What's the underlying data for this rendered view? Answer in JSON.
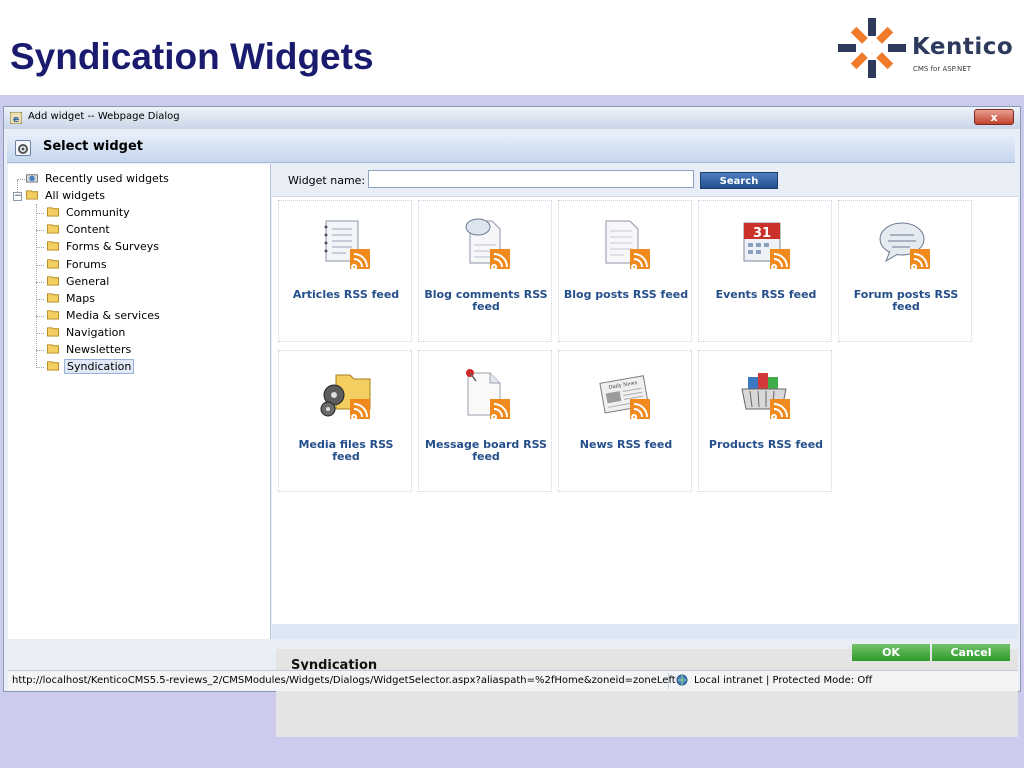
{
  "slide": {
    "title": "Syndication Widgets",
    "logo_name": "Kentico",
    "logo_tagline": "CMS for ASP.NET"
  },
  "window": {
    "title": "Add widget -- Webpage Dialog",
    "close_label": "x"
  },
  "dialog": {
    "header": "Select widget"
  },
  "tree": {
    "recent": "Recently used widgets",
    "root": "All widgets",
    "items": [
      "Community",
      "Content",
      "Forms & Surveys",
      "Forums",
      "General",
      "Maps",
      "Media & services",
      "Navigation",
      "Newsletters",
      "Syndication"
    ],
    "selected": "Syndication"
  },
  "search": {
    "label": "Widget name:",
    "value": "",
    "button": "Search"
  },
  "widgets": [
    {
      "name": "Articles RSS feed",
      "icon": "articles-rss-icon"
    },
    {
      "name": "Blog comments RSS feed",
      "icon": "blog-comments-rss-icon"
    },
    {
      "name": "Blog posts RSS feed",
      "icon": "blog-posts-rss-icon"
    },
    {
      "name": "Events RSS feed",
      "icon": "events-rss-icon"
    },
    {
      "name": "Forum posts RSS feed",
      "icon": "forum-posts-rss-icon"
    },
    {
      "name": "Media files RSS feed",
      "icon": "media-files-rss-icon"
    },
    {
      "name": "Message board RSS feed",
      "icon": "message-board-rss-icon"
    },
    {
      "name": "News RSS feed",
      "icon": "news-rss-icon"
    },
    {
      "name": "Products RSS feed",
      "icon": "products-rss-icon"
    }
  ],
  "events_calendar_day": "31",
  "news_paper_label": "Daily News",
  "info": {
    "title": "Syndication"
  },
  "buttons": {
    "ok": "OK",
    "cancel": "Cancel"
  },
  "status": {
    "url": "http://localhost/KenticoCMS5.5-reviews_2/CMSModules/Widgets/Dialogs/WidgetSelector.aspx?aliaspath=%2fHome&zoneid=zoneLeft",
    "zone": "Local intranet | Protected Mode: Off"
  },
  "colors": {
    "title": "#1a1a6e",
    "accent_blue": "#244f8a",
    "ok_green": "#2f9a2c",
    "rss_orange": "#f08a1c",
    "slide_bg": "#cccbee"
  }
}
